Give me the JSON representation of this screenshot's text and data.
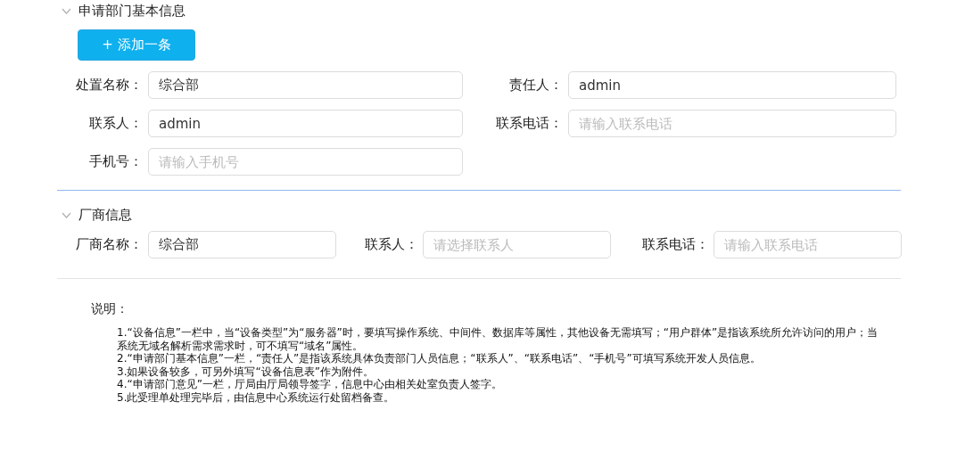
{
  "sections": [
    {
      "title": "申请部门基本信息",
      "expanded": true,
      "add_button": "+ 添加一条",
      "fields": [
        {
          "label": "处置名称：",
          "value": "综合部"
        },
        {
          "label": "责任人：",
          "value": "admin"
        },
        {
          "label": "联系人：",
          "value": "admin"
        },
        {
          "label": "联系电话：",
          "placeholder": "请输入联系电话"
        },
        {
          "label": "手机号：",
          "placeholder": "请输入手机号"
        }
      ]
    },
    {
      "title": "厂商信息",
      "expanded": true,
      "fields": [
        {
          "label": "厂商名称：",
          "value": "综合部"
        },
        {
          "label": "联系人：",
          "placeholder": "请选择联系人"
        },
        {
          "label": "联系电话：",
          "placeholder": "请输入联系电话"
        }
      ]
    }
  ],
  "notes": {
    "title": "说明：",
    "items": [
      "1.“设备信息”一栏中，当“设备类型”为“服务器”时，要填写操作系统、中间件、数据库等属性，其他设备无需填写；“用户群体”是指该系统所允许访问的用户；当系统无域名解析需求需求时，可不填写“域名”属性。",
      "2.“申请部门基本信息”一栏，“责任人”是指该系统具体负责部门人员信息；“联系人”、“联系电话”、“手机号”可填写系统开发人员信息。",
      "3.如果设备较多，可另外填写“设备信息表”作为附件。",
      "4.“申请部门意见”一栏，厅局由厅局领导签字，信息中心由相关处室负责人签字。",
      "5.此受理单处理完毕后，由信息中心系统运行处留档备查。"
    ]
  }
}
